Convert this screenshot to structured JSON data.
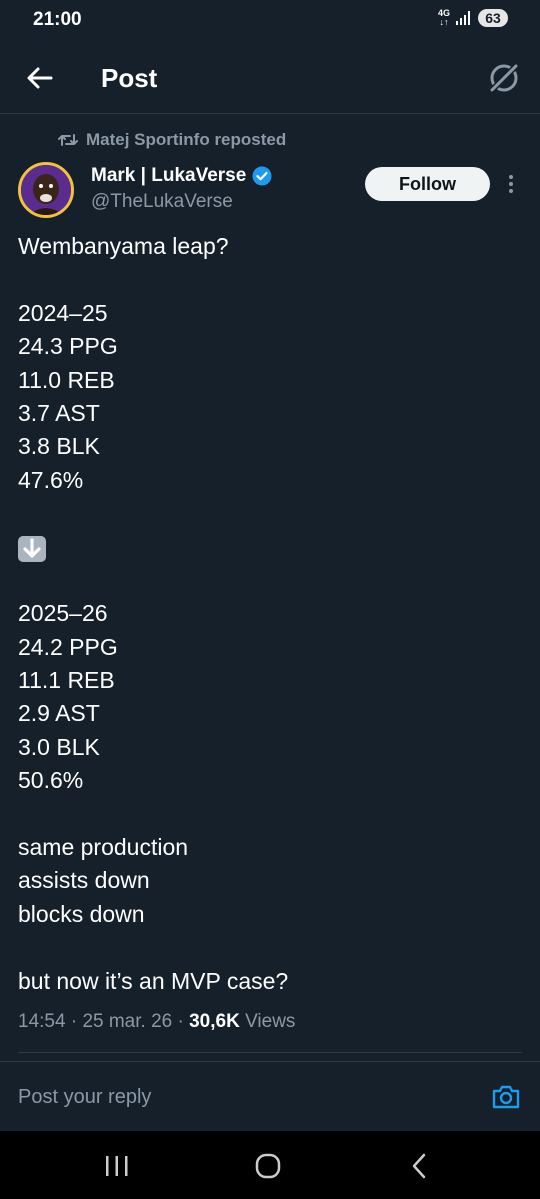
{
  "status_bar": {
    "time": "21:00",
    "network": "4G",
    "battery": "63"
  },
  "header": {
    "title": "Post"
  },
  "repost": {
    "text": "Matej Sportinfo reposted"
  },
  "author": {
    "name": "Mark | LukaVerse",
    "handle": "@TheLukaVerse",
    "follow_label": "Follow"
  },
  "post": {
    "lines": [
      "Wembanyama leap?",
      "",
      "2024–25",
      "24.3 PPG",
      "11.0 REB",
      "3.7 AST",
      "3.8 BLK",
      "47.6%",
      "",
      "⬇️",
      "",
      "2025–26",
      "24.2 PPG",
      "11.1 REB",
      "2.9 AST",
      "3.0 BLK",
      "50.6%",
      "",
      "same production",
      "assists down",
      "blocks down",
      "",
      "but now it’s an MVP case?"
    ],
    "time": "14:54",
    "date": "25 mar. 26",
    "views_count": "30,6K",
    "views_label": "Views"
  },
  "reply": {
    "placeholder": "Post your reply"
  },
  "colors": {
    "background": "#15202b",
    "accent": "#1d9bf0",
    "muted": "#8b98a5",
    "verified": "#1d9bf0"
  },
  "icons": [
    "back-arrow-icon",
    "grok-icon",
    "repost-icon",
    "verified-badge-icon",
    "more-vertical-icon",
    "camera-icon",
    "recent-apps-icon",
    "home-icon",
    "back-icon"
  ]
}
